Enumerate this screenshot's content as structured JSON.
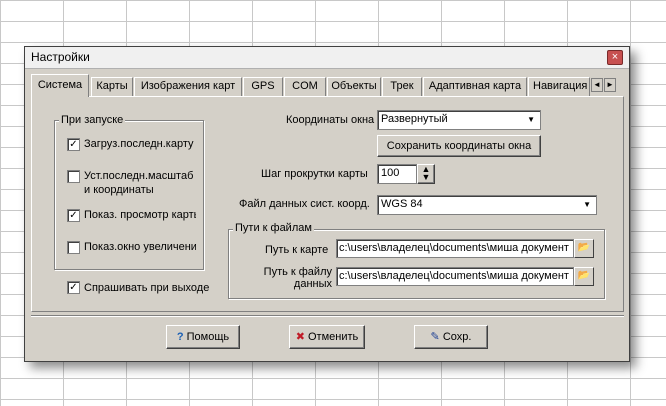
{
  "dialog": {
    "title": "Настройки",
    "close_label": "×"
  },
  "tabs": [
    "Система",
    "Карты",
    "Изображения карт",
    "GPS",
    "COM",
    "Объекты",
    "Трек",
    "Адаптивная карта",
    "Навигация"
  ],
  "tab_scroll": {
    "left": "◄",
    "right": "►"
  },
  "startup": {
    "title": "При запуске",
    "items": [
      {
        "label": "Загруз.последн.карту",
        "checked": true
      },
      {
        "label": "Уст.последн.масштаб\nи координаты",
        "checked": false
      },
      {
        "label": "Показ. просмотр карты",
        "checked": true
      },
      {
        "label": "Показ.окно увеличения",
        "checked": false
      }
    ]
  },
  "ask_on_exit": {
    "label": "Спрашивать при выходе",
    "checked": true
  },
  "window_coords": {
    "label": "Координаты окна",
    "value": "Развернутый"
  },
  "save_coords_button": "Сохранить координаты окна",
  "scroll_step": {
    "label": "Шаг прокрутки карты",
    "value": "100"
  },
  "datum_file": {
    "label": "Файл данных сист. коорд.",
    "value": "WGS 84"
  },
  "paths": {
    "title": "Пути к файлам",
    "map_path_label": "Путь к карте",
    "map_path_value": "c:\\users\\владелец\\documents\\миша документ",
    "data_path_label": "Путь к файлу\nданных",
    "data_path_value": "c:\\users\\владелец\\documents\\миша документ"
  },
  "buttons": {
    "help": "Помощь",
    "cancel": "Отменить",
    "save": "Сохр."
  },
  "icons": {
    "check": "✓",
    "dropdown": "▼",
    "folder": "📂",
    "help": "?",
    "cancel": "✖",
    "save": "✎"
  }
}
